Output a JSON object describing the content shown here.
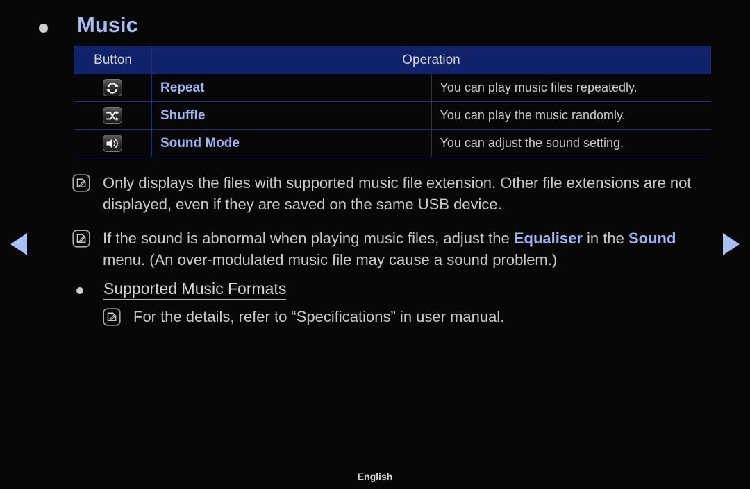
{
  "page": {
    "title": "Music",
    "footer_language": "English"
  },
  "nav": {
    "prev_icon": "triangle-left-icon",
    "next_icon": "triangle-right-icon",
    "accent_color": "#a9c0f7"
  },
  "table": {
    "headers": [
      "Button",
      "Operation"
    ],
    "header_bg": "#10226a",
    "rows": [
      {
        "icon": "repeat-icon",
        "label": "Repeat",
        "operation": "You can play music files repeatedly."
      },
      {
        "icon": "shuffle-icon",
        "label": "Shuffle",
        "operation": "You can play the music randomly."
      },
      {
        "icon": "sound-mode-icon",
        "label": "Sound Mode",
        "operation": "You can adjust the sound setting."
      }
    ]
  },
  "notes": [
    {
      "icon": "note-icon",
      "text": "Only displays the files with supported music file extension. Other file extensions are not displayed, even if they are saved on the same USB device."
    },
    {
      "icon": "note-icon",
      "text_part1": "If the sound is abnormal when playing music files, adjust the ",
      "emphasis1": "Equaliser",
      "text_part2": " in the ",
      "emphasis2": "Sound",
      "text_part3": " menu. (An over-modulated music file may cause a sound problem.)"
    }
  ],
  "formats_section": {
    "bullet": "bullet-small",
    "title": "Supported Music Formats",
    "note": {
      "icon": "note-icon",
      "text": "For the details, refer to “Specifications” in user manual."
    }
  },
  "colors": {
    "background": "#070707",
    "heading_blue": "#a8bcf0",
    "body_gray": "#c9c9c9",
    "table_border": "#1d2f77"
  }
}
